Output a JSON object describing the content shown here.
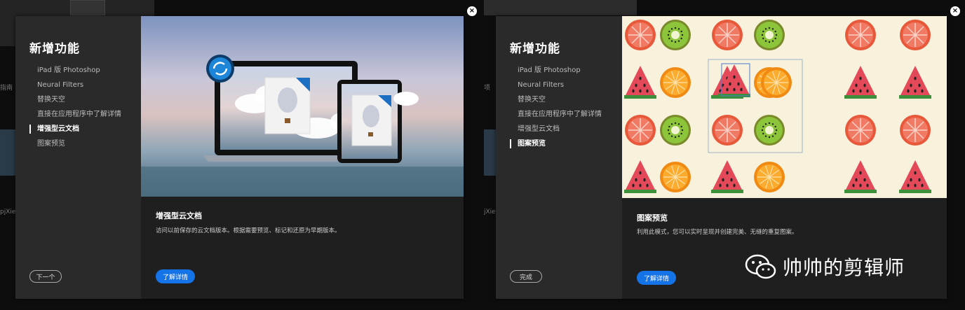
{
  "dialogs": [
    {
      "title": "新增功能",
      "menu": [
        "iPad 版 Photoshop",
        "Neural Filters",
        "替换天空",
        "直接在应用程序中了解详情",
        "增强型云文档",
        "图案预览"
      ],
      "active_index": 4,
      "content_title": "增强型云文档",
      "content_desc": "访问以前保存的云文档版本。根据需要预览、标记和还原为早期版本。",
      "learn_more": "了解详情",
      "nav_button": "下一个",
      "close": "×"
    },
    {
      "title": "新增功能",
      "menu": [
        "iPad 版 Photoshop",
        "Neural Filters",
        "替换天空",
        "直接在应用程序中了解详情",
        "增强型云文档",
        "图案预览"
      ],
      "active_index": 5,
      "content_title": "图案预览",
      "content_desc": "利用此模式，您可以实时呈现并创建完美、无缝的重复图案。",
      "learn_more": "了解详情",
      "nav_button": "完成",
      "close": "×"
    }
  ],
  "background": {
    "left_labels": [
      "指南",
      "pjXieF"
    ],
    "right_labels": [
      "项",
      "jXieF"
    ]
  },
  "watermark": {
    "text": "帅帅的剪辑师"
  },
  "colors": {
    "accent": "#1473e6",
    "panel": "#2a2a2a",
    "content": "#1f1f1f",
    "pattern_bg": "#f8f2dc"
  }
}
